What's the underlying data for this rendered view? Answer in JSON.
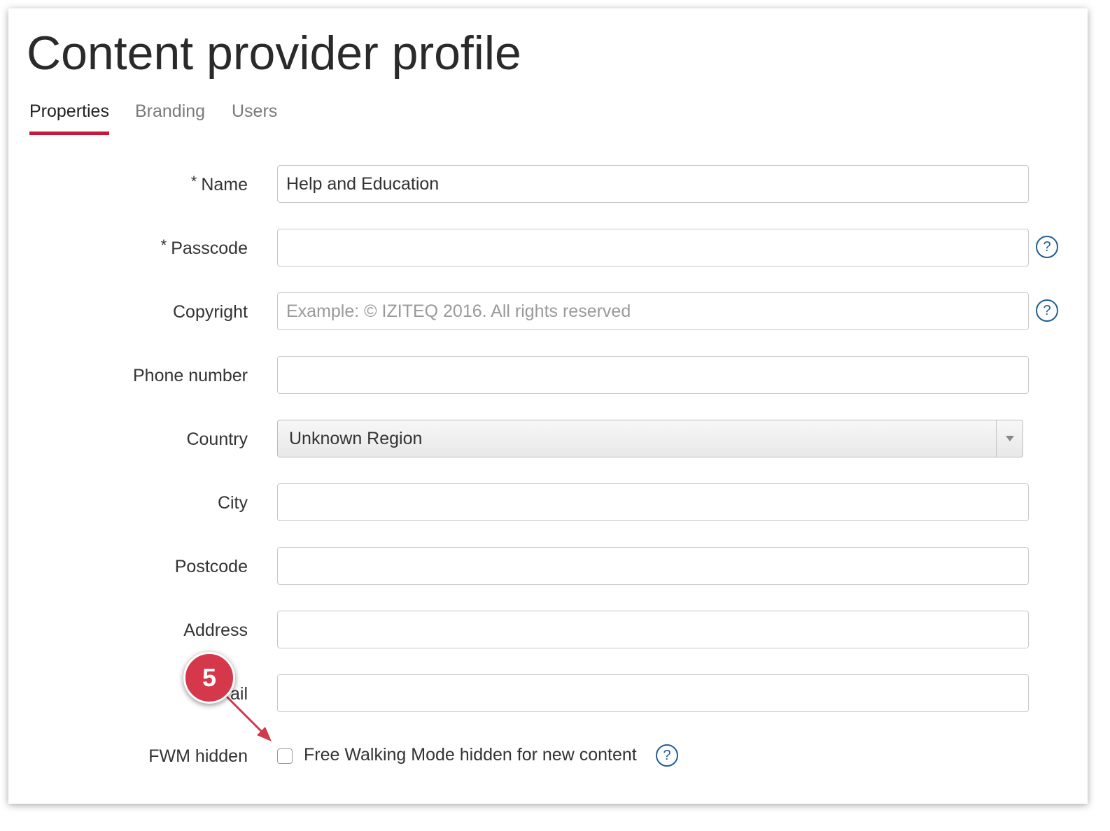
{
  "page": {
    "title": "Content provider profile"
  },
  "tabs": [
    {
      "label": "Properties",
      "active": true
    },
    {
      "label": "Branding",
      "active": false
    },
    {
      "label": "Users",
      "active": false
    }
  ],
  "form": {
    "name": {
      "label": "Name",
      "required_mark": "*",
      "value": "Help and Education"
    },
    "passcode": {
      "label": "Passcode",
      "required_mark": "*",
      "value": ""
    },
    "copyright": {
      "label": "Copyright",
      "value": "",
      "placeholder": "Example: © IZITEQ 2016. All rights reserved"
    },
    "phone": {
      "label": "Phone number",
      "value": ""
    },
    "country": {
      "label": "Country",
      "value": "Unknown Region"
    },
    "city": {
      "label": "City",
      "value": ""
    },
    "postcode": {
      "label": "Postcode",
      "value": ""
    },
    "address": {
      "label": "Address",
      "value": ""
    },
    "email": {
      "label": "ail",
      "value": ""
    },
    "fwm": {
      "label": "FWM hidden",
      "checkbox_label": "Free Walking Mode hidden for new content",
      "checked": false
    }
  },
  "help_icon": {
    "glyph": "?",
    "icon": "question-circle-icon",
    "color": "#1f5d99"
  },
  "annotation": {
    "number": "5",
    "color": "#d4384a"
  },
  "colors": {
    "accent": "#c8173a",
    "text": "#333333",
    "muted": "#7a7a7a"
  }
}
